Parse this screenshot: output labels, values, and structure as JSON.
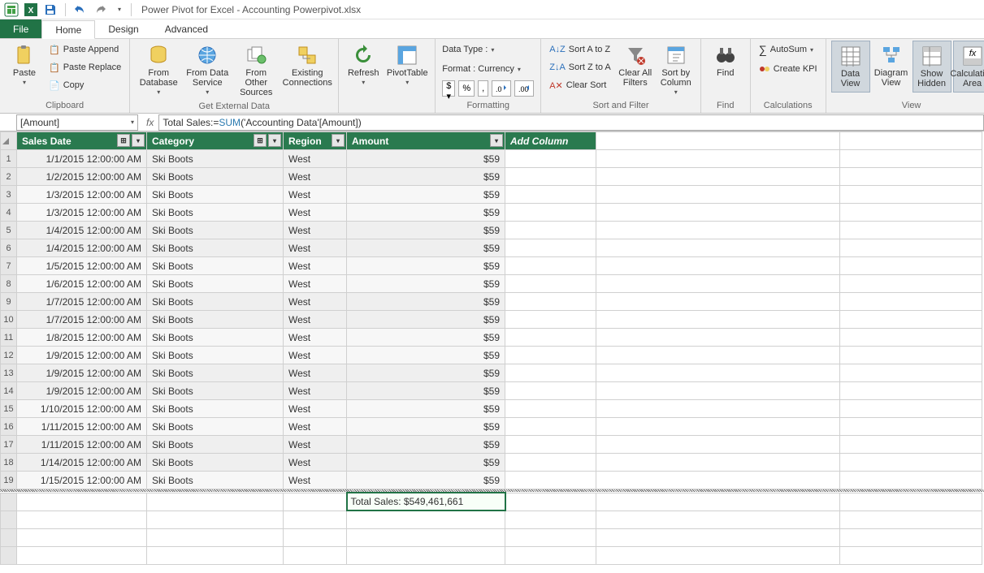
{
  "title": "Power Pivot for Excel - Accounting Powerpivot.xlsx",
  "tabs": {
    "file": "File",
    "home": "Home",
    "design": "Design",
    "advanced": "Advanced"
  },
  "ribbon": {
    "clipboard": {
      "paste": "Paste",
      "paste_append": "Paste Append",
      "paste_replace": "Paste Replace",
      "copy": "Copy",
      "label": "Clipboard"
    },
    "getdata": {
      "from_db": "From Database",
      "from_ds": "From Data Service",
      "from_other": "From Other Sources",
      "existing": "Existing Connections",
      "label": "Get External Data"
    },
    "refresh": "Refresh",
    "pivot": "PivotTable",
    "formatting": {
      "data_type": "Data Type :",
      "format": "Format : Currency",
      "currency_symbol": "$",
      "percent": "%",
      "comma": ",",
      "dec_inc": ".0",
      "dec_dec": ".00",
      "label": "Formatting"
    },
    "sort": {
      "az": "Sort A to Z",
      "za": "Sort Z to A",
      "clear": "Clear Sort",
      "clear_filters": "Clear All Filters",
      "sortby": "Sort by Column",
      "label": "Sort and Filter"
    },
    "find": {
      "find": "Find",
      "label": "Find"
    },
    "calc": {
      "autosum": "AutoSum",
      "kpi": "Create KPI",
      "label": "Calculations"
    },
    "view": {
      "data": "Data View",
      "diagram": "Diagram View",
      "hidden": "Show Hidden",
      "calc_area": "Calculation Area",
      "label": "View"
    }
  },
  "namebox": "[Amount]",
  "formula": {
    "prefix": "Total Sales:=",
    "func": "SUM",
    "suffix": "('Accounting Data'[Amount])"
  },
  "columns": {
    "date": "Sales Date",
    "category": "Category",
    "region": "Region",
    "amount": "Amount",
    "add": "Add Column"
  },
  "rows": [
    {
      "n": "1",
      "date": "1/1/2015 12:00:00 AM",
      "cat": "Ski Boots",
      "reg": "West",
      "amt": "$59"
    },
    {
      "n": "2",
      "date": "1/2/2015 12:00:00 AM",
      "cat": "Ski Boots",
      "reg": "West",
      "amt": "$59"
    },
    {
      "n": "3",
      "date": "1/3/2015 12:00:00 AM",
      "cat": "Ski Boots",
      "reg": "West",
      "amt": "$59"
    },
    {
      "n": "4",
      "date": "1/3/2015 12:00:00 AM",
      "cat": "Ski Boots",
      "reg": "West",
      "amt": "$59"
    },
    {
      "n": "5",
      "date": "1/4/2015 12:00:00 AM",
      "cat": "Ski Boots",
      "reg": "West",
      "amt": "$59"
    },
    {
      "n": "6",
      "date": "1/4/2015 12:00:00 AM",
      "cat": "Ski Boots",
      "reg": "West",
      "amt": "$59"
    },
    {
      "n": "7",
      "date": "1/5/2015 12:00:00 AM",
      "cat": "Ski Boots",
      "reg": "West",
      "amt": "$59"
    },
    {
      "n": "8",
      "date": "1/6/2015 12:00:00 AM",
      "cat": "Ski Boots",
      "reg": "West",
      "amt": "$59"
    },
    {
      "n": "9",
      "date": "1/7/2015 12:00:00 AM",
      "cat": "Ski Boots",
      "reg": "West",
      "amt": "$59"
    },
    {
      "n": "10",
      "date": "1/7/2015 12:00:00 AM",
      "cat": "Ski Boots",
      "reg": "West",
      "amt": "$59"
    },
    {
      "n": "11",
      "date": "1/8/2015 12:00:00 AM",
      "cat": "Ski Boots",
      "reg": "West",
      "amt": "$59"
    },
    {
      "n": "12",
      "date": "1/9/2015 12:00:00 AM",
      "cat": "Ski Boots",
      "reg": "West",
      "amt": "$59"
    },
    {
      "n": "13",
      "date": "1/9/2015 12:00:00 AM",
      "cat": "Ski Boots",
      "reg": "West",
      "amt": "$59"
    },
    {
      "n": "14",
      "date": "1/9/2015 12:00:00 AM",
      "cat": "Ski Boots",
      "reg": "West",
      "amt": "$59"
    },
    {
      "n": "15",
      "date": "1/10/2015 12:00:00 AM",
      "cat": "Ski Boots",
      "reg": "West",
      "amt": "$59"
    },
    {
      "n": "16",
      "date": "1/11/2015 12:00:00 AM",
      "cat": "Ski Boots",
      "reg": "West",
      "amt": "$59"
    },
    {
      "n": "17",
      "date": "1/11/2015 12:00:00 AM",
      "cat": "Ski Boots",
      "reg": "West",
      "amt": "$59"
    },
    {
      "n": "18",
      "date": "1/14/2015 12:00:00 AM",
      "cat": "Ski Boots",
      "reg": "West",
      "amt": "$59"
    },
    {
      "n": "19",
      "date": "1/15/2015 12:00:00 AM",
      "cat": "Ski Boots",
      "reg": "West",
      "amt": "$59"
    }
  ],
  "measure": "Total Sales: $549,461,661"
}
